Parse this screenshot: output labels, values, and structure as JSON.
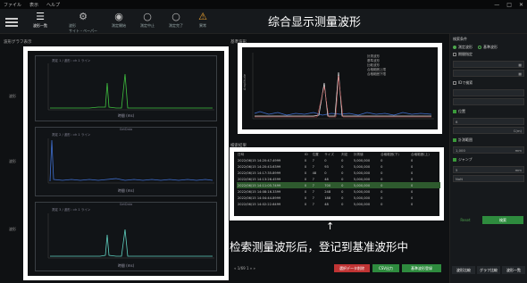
{
  "menubar": {
    "items": [
      "ファイル",
      "表示",
      "ヘルプ"
    ],
    "win": [
      "—",
      "□",
      "✕"
    ]
  },
  "toolbar": {
    "buttons": [
      {
        "label": "波形一覧",
        "icon": "list-icon"
      },
      {
        "label": "波形\nサイト・ペーパー",
        "icon": "gear-icon"
      },
      {
        "label": "測定開始",
        "icon": "play-icon"
      },
      {
        "label": "測定中止",
        "icon": "circle-icon"
      },
      {
        "label": "測定完了",
        "icon": "circle-icon"
      },
      {
        "label": "異常",
        "icon": "warning-icon"
      }
    ]
  },
  "left": {
    "section_title": "波形グラフ表示",
    "side_labels": [
      "波形",
      "波形",
      "波形"
    ],
    "charts": [
      {
        "title": "測定 1 / 波形 : ch 1 ライン",
        "top": "",
        "xlabel": "時間 (ms)",
        "xticks": [
          "747.0",
          "748",
          "749.0",
          "749",
          "749.5",
          "750"
        ]
      },
      {
        "title": "測定 2 / 波形 : ch 1 ライン",
        "top": "GetData",
        "xlabel": "時間 (ms)",
        "xticks": [
          "747.0",
          "748",
          "749.0",
          "749",
          "749.5",
          "750"
        ]
      },
      {
        "title": "測定 3 / 波形 : ch 1 ライン",
        "top": "GetData",
        "xlabel": "時間 (ms)",
        "xticks": [
          "747.0",
          "748",
          "749.0",
          "749",
          "749.5",
          "750"
        ]
      }
    ]
  },
  "compare": {
    "section_title": "基準波形",
    "ylabel": "Amplitude",
    "legend": [
      "計測波形",
      "基準波形",
      "比較波形",
      "合格範囲上限",
      "合格範囲下限"
    ],
    "xticks": [
      "747.0",
      "748",
      "749.0",
      "749",
      "749.5"
    ]
  },
  "table": {
    "title": "検索結果",
    "headers": [
      "日時",
      "ID",
      "位置",
      "サイズ",
      "判定",
      "計測値",
      "合格範囲(下)",
      "合格範囲(上)",
      "時間"
    ],
    "rows": [
      [
        "2022/06/15 14:20:47.4999",
        "0",
        "7",
        "0",
        "0",
        "5,000,000",
        "0",
        "0"
      ],
      [
        "2022/06/15 14:20:43.6399",
        "0",
        "7",
        "93",
        "0",
        "5,000,000",
        "0",
        "0"
      ],
      [
        "2022/06/15 14:17:35.8999",
        "0",
        "48",
        "0",
        "0",
        "5,000,000",
        "0",
        "0"
      ],
      [
        "2022/06/15 14:13:26.4599",
        "0",
        "7",
        "48",
        "0",
        "5,000,000",
        "0",
        "0"
      ],
      [
        "2022/06/15 14:11:05.7499",
        "0",
        "7",
        "700",
        "0",
        "5,000,000",
        "0",
        "0"
      ],
      [
        "2022/06/15 14:08:16.3399",
        "0",
        "7",
        "248",
        "0",
        "5,000,000",
        "0",
        "0"
      ],
      [
        "2022/06/15 14:04:44.8999",
        "0",
        "7",
        "188",
        "0",
        "5,000,000",
        "0",
        "0"
      ],
      [
        "2022/06/15 14:02:22.6499",
        "0",
        "7",
        "48",
        "0",
        "5,000,000",
        "0",
        "0"
      ]
    ],
    "selected_row": 4,
    "pager": "« 1/69 1 » »",
    "buttons": [
      "選択データ削除",
      "CSV出力",
      "基準波形登録"
    ]
  },
  "right": {
    "title": "検索条件",
    "radios": [
      "測定波形",
      "基準波形"
    ],
    "fields": [
      {
        "check": "期間指定",
        "checked": false,
        "value": "",
        "unit": ""
      },
      {
        "check": "",
        "checked": false,
        "value": "",
        "unit": ""
      },
      {
        "check": "IDで検索",
        "checked": false,
        "value": "",
        "unit": ""
      },
      {
        "check": "",
        "checked": false,
        "value": "",
        "unit": ""
      },
      {
        "check": "位置",
        "checked": true,
        "value": "6",
        "unit": ""
      },
      {
        "check": "",
        "checked": false,
        "value": "",
        "unit": "C(m)"
      },
      {
        "check": "計測範囲",
        "checked": true,
        "value": "1,000",
        "unit": "mm"
      },
      {
        "check": "ジャンプ",
        "checked": true,
        "value": "5",
        "unit": "mm"
      },
      {
        "check": "",
        "checked": false,
        "value": "NoN",
        "unit": ""
      }
    ],
    "reset": "Reset",
    "search": "検索",
    "bottom": [
      "波形比較",
      "グラフ比較",
      "波形一覧"
    ]
  },
  "annotations": {
    "top": "综合显示测量波形",
    "bottom": "检索测量波形后，登记到基准波形中",
    "arrow": "↑"
  },
  "colors": {
    "green": "#3fbf3f",
    "blue": "#3f6fd0",
    "cyan": "#5fd0c0"
  }
}
